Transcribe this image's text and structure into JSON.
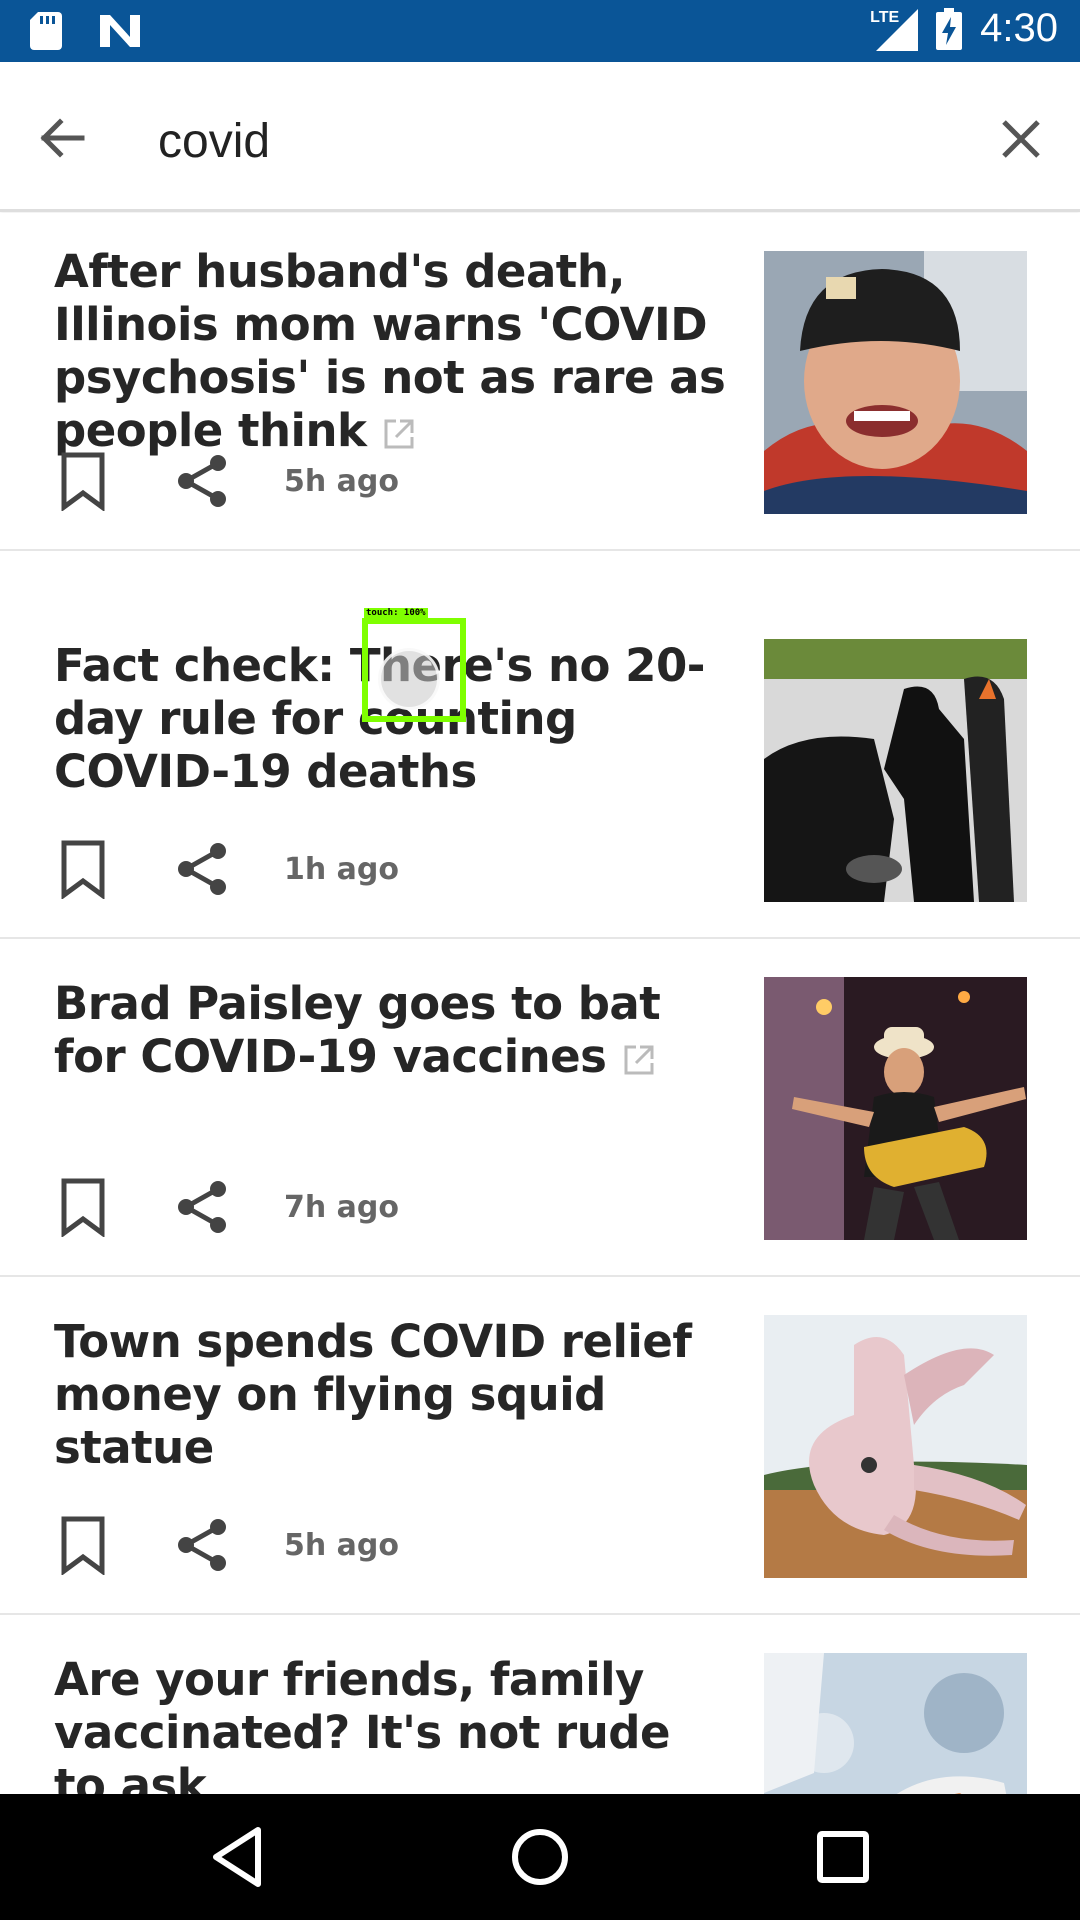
{
  "status_bar": {
    "time": "4:30",
    "network": "LTE",
    "icons": [
      "sd-card-icon",
      "n-logo-icon",
      "signal-icon",
      "battery-charging-icon"
    ],
    "background": "#0a5597"
  },
  "search": {
    "query": "covid",
    "back_icon": "arrow-left-icon",
    "clear_icon": "close-icon"
  },
  "articles": [
    {
      "headline": "After husband's death, Illinois mom warns 'COVID psychosis' is not as rare as people think",
      "external_link": true,
      "time": "5h ago",
      "thumbnail": "man in beanie smiling"
    },
    {
      "headline": "Fact check: There's no 20-day rule for counting COVID-19 deaths",
      "external_link": false,
      "time": "1h ago",
      "thumbnail": "drive-through testing silhouettes"
    },
    {
      "headline": "Brad Paisley goes to bat for COVID-19 vaccines",
      "external_link": true,
      "time": "7h ago",
      "thumbnail": "guitarist performing on stage"
    },
    {
      "headline": "Town spends COVID relief money on flying squid statue",
      "external_link": false,
      "time": "5h ago",
      "thumbnail": "pink squid statue"
    },
    {
      "headline": "Are your friends, family vaccinated? It's not rude to ask",
      "external_link": false,
      "time": "",
      "thumbnail": "gloved hand with syringe"
    }
  ],
  "touch_indicator": {
    "label": "touch: 100%"
  },
  "nav_bar": {
    "back_icon": "nav-back-icon",
    "home_icon": "nav-home-icon",
    "recents_icon": "nav-recents-icon"
  }
}
